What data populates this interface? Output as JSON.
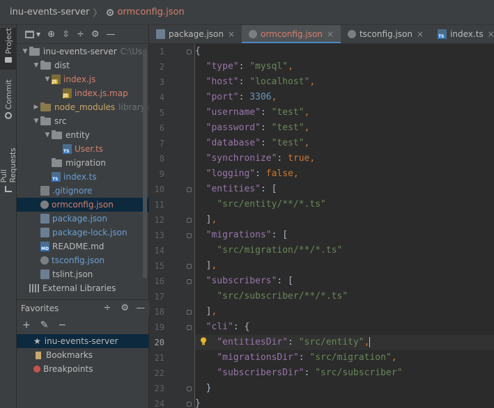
{
  "breadcrumb": {
    "project": "inu-events-server",
    "file": "ormconfig.json"
  },
  "toolwindow_tabs": [
    "Project",
    "Commit",
    "Pull Requests"
  ],
  "tree": [
    {
      "label": "inu-events-server",
      "suffix": "C:\\Use",
      "depth": 0,
      "kind": "folder",
      "open": true
    },
    {
      "label": "dist",
      "depth": 1,
      "kind": "folder",
      "open": true
    },
    {
      "label": "index.js",
      "depth": 2,
      "kind": "js",
      "open": true,
      "color": "red"
    },
    {
      "label": "index.js.map",
      "depth": 3,
      "kind": "map",
      "color": "red"
    },
    {
      "label": "node_modules",
      "suffix": "library ro",
      "depth": 1,
      "kind": "folder-excl",
      "open": false,
      "color": "gold"
    },
    {
      "label": "src",
      "depth": 1,
      "kind": "folder",
      "open": true
    },
    {
      "label": "entity",
      "depth": 2,
      "kind": "folder",
      "open": true
    },
    {
      "label": "User.ts",
      "depth": 3,
      "kind": "ts",
      "color": "red"
    },
    {
      "label": "migration",
      "depth": 2,
      "kind": "folder"
    },
    {
      "label": "index.ts",
      "depth": 2,
      "kind": "ts",
      "color": "blue"
    },
    {
      "label": ".gitignore",
      "depth": 1,
      "kind": "git",
      "color": "blue"
    },
    {
      "label": "ormconfig.json",
      "depth": 1,
      "kind": "cfg",
      "color": "red",
      "selected": true
    },
    {
      "label": "package.json",
      "depth": 1,
      "kind": "json",
      "color": "blue"
    },
    {
      "label": "package-lock.json",
      "depth": 1,
      "kind": "json",
      "color": "blue"
    },
    {
      "label": "README.md",
      "depth": 1,
      "kind": "md"
    },
    {
      "label": "tsconfig.json",
      "depth": 1,
      "kind": "cfg",
      "color": "blue"
    },
    {
      "label": "tslint.json",
      "depth": 1,
      "kind": "json"
    },
    {
      "label": "External Libraries",
      "depth": 0,
      "kind": "lib"
    }
  ],
  "favorites": {
    "title": "Favorites",
    "items": [
      {
        "label": "inu-events-server",
        "icon": "star-icon",
        "selected": true
      },
      {
        "label": "Bookmarks",
        "icon": "bookmark-icon"
      },
      {
        "label": "Breakpoints",
        "icon": "breakpoint-icon"
      }
    ]
  },
  "tabs": [
    {
      "label": "package.json",
      "icon": "json"
    },
    {
      "label": "ormconfig.json",
      "icon": "cfg",
      "active": true
    },
    {
      "label": "tsconfig.json",
      "icon": "cfg"
    },
    {
      "label": "index.ts",
      "icon": "ts"
    },
    {
      "label": "U",
      "icon": "ts"
    }
  ],
  "editor": {
    "current_line": 20,
    "lines": [
      [
        [
          "p",
          "{"
        ]
      ],
      [
        [
          "p",
          "  "
        ],
        [
          "k",
          "\"type\""
        ],
        [
          "p",
          ": "
        ],
        [
          "s",
          "\"mysql\""
        ],
        [
          "b",
          ","
        ]
      ],
      [
        [
          "p",
          "  "
        ],
        [
          "k",
          "\"host\""
        ],
        [
          "p",
          ": "
        ],
        [
          "s",
          "\"localhost\""
        ],
        [
          "b",
          ","
        ]
      ],
      [
        [
          "p",
          "  "
        ],
        [
          "k",
          "\"port\""
        ],
        [
          "p",
          ": "
        ],
        [
          "n",
          "3306"
        ],
        [
          "b",
          ","
        ]
      ],
      [
        [
          "p",
          "  "
        ],
        [
          "k",
          "\"username\""
        ],
        [
          "p",
          ": "
        ],
        [
          "s",
          "\"test\""
        ],
        [
          "b",
          ","
        ]
      ],
      [
        [
          "p",
          "  "
        ],
        [
          "k",
          "\"password\""
        ],
        [
          "p",
          ": "
        ],
        [
          "s",
          "\"test\""
        ],
        [
          "b",
          ","
        ]
      ],
      [
        [
          "p",
          "  "
        ],
        [
          "k",
          "\"database\""
        ],
        [
          "p",
          ": "
        ],
        [
          "s",
          "\"test\""
        ],
        [
          "b",
          ","
        ]
      ],
      [
        [
          "p",
          "  "
        ],
        [
          "k",
          "\"synchronize\""
        ],
        [
          "p",
          ": "
        ],
        [
          "b",
          "true,"
        ]
      ],
      [
        [
          "p",
          "  "
        ],
        [
          "k",
          "\"logging\""
        ],
        [
          "p",
          ": "
        ],
        [
          "b",
          "false,"
        ]
      ],
      [
        [
          "p",
          "  "
        ],
        [
          "k",
          "\"entities\""
        ],
        [
          "p",
          ": ["
        ]
      ],
      [
        [
          "p",
          "    "
        ],
        [
          "s",
          "\"src/entity/**/*.ts\""
        ]
      ],
      [
        [
          "p",
          "  ]"
        ],
        [
          "b",
          ","
        ]
      ],
      [
        [
          "p",
          "  "
        ],
        [
          "k",
          "\"migrations\""
        ],
        [
          "p",
          ": ["
        ]
      ],
      [
        [
          "p",
          "    "
        ],
        [
          "s",
          "\"src/migration/**/*.ts\""
        ]
      ],
      [
        [
          "p",
          "  ]"
        ],
        [
          "b",
          ","
        ]
      ],
      [
        [
          "p",
          "  "
        ],
        [
          "k",
          "\"subscribers\""
        ],
        [
          "p",
          ": ["
        ]
      ],
      [
        [
          "p",
          "    "
        ],
        [
          "s",
          "\"src/subscriber/**/*.ts\""
        ]
      ],
      [
        [
          "p",
          "  ]"
        ],
        [
          "b",
          ","
        ]
      ],
      [
        [
          "p",
          "  "
        ],
        [
          "k",
          "\"cli\""
        ],
        [
          "p",
          ": {"
        ]
      ],
      [
        [
          "p",
          "    "
        ],
        [
          "k",
          "\"entitiesDir\""
        ],
        [
          "p",
          ": "
        ],
        [
          "s",
          "\"src/entity\""
        ],
        [
          "b",
          ","
        ]
      ],
      [
        [
          "p",
          "    "
        ],
        [
          "k",
          "\"migrationsDir\""
        ],
        [
          "p",
          ": "
        ],
        [
          "s",
          "\"src/migration\""
        ],
        [
          "b",
          ","
        ]
      ],
      [
        [
          "p",
          "    "
        ],
        [
          "k",
          "\"subscribersDir\""
        ],
        [
          "p",
          ": "
        ],
        [
          "s",
          "\"src/subscriber\""
        ]
      ],
      [
        [
          "p",
          "  }"
        ]
      ],
      [
        [
          "p",
          "}"
        ]
      ]
    ],
    "fold_markers": [
      1,
      10,
      12,
      13,
      15,
      16,
      18,
      19,
      23,
      24
    ]
  }
}
